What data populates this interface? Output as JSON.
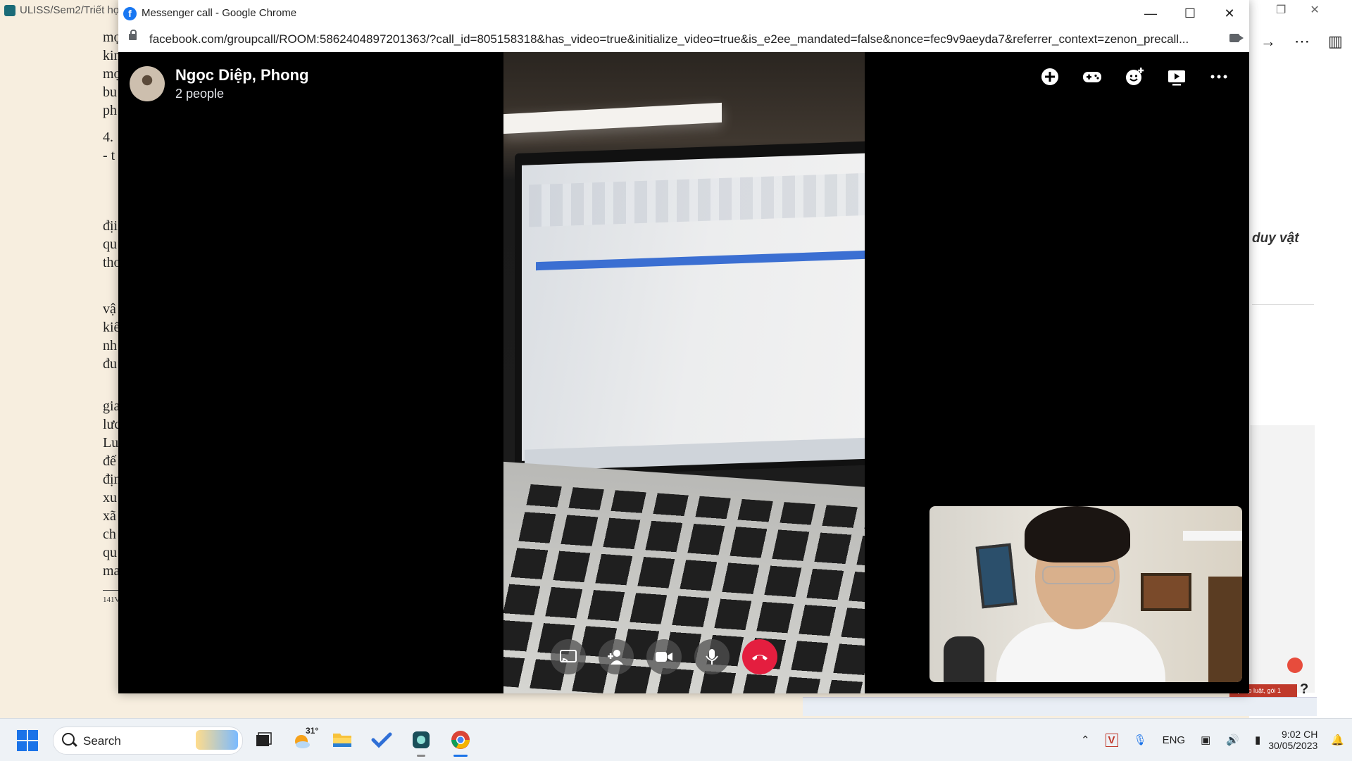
{
  "background": {
    "tab_title": "ULISS/Sem2/Triết học",
    "page_line_fragments": [
      "mọ",
      "kin",
      "mọ",
      "bu",
      "ph",
      "4.",
      "- t",
      "địi",
      "qu",
      "thơ",
      "vậ",
      "kiế",
      "nh",
      "đu",
      "gia",
      "lưc",
      "Lu",
      "đế",
      "địn",
      "xu",
      "xã",
      "ch",
      "qu",
      "ma"
    ],
    "footnote": "141V",
    "right_heading": "duy vật",
    "help_label": "?",
    "toast_text": "n pháp luật, gói 1"
  },
  "window": {
    "title": "Messenger call - Google Chrome",
    "url": "facebook.com/groupcall/ROOM:5862404897201363/?call_id=805158318&has_video=true&initialize_video=true&is_e2ee_mandated=false&nonce=fec9v9aeyda7&referrer_context=zenon_precall..."
  },
  "call": {
    "name": "Ngọc Diệp, Phong",
    "participants": "2 people",
    "top_actions": [
      "add-icon",
      "game-controller-icon",
      "effects-icon",
      "play-screen-icon",
      "more-icon"
    ],
    "controls": [
      "share-screen-icon",
      "add-person-icon",
      "camera-icon",
      "microphone-icon",
      "end-call-icon"
    ],
    "end_color": "#e41e3f"
  },
  "taskbar": {
    "search_label": "Search",
    "weather_temp": "31°",
    "apps": [
      "task-view-icon",
      "weather-icon",
      "file-explorer-icon",
      "todo-icon",
      "app-icon",
      "chrome-icon"
    ],
    "tray_lang": "ENG",
    "time": "9:02 CH",
    "date": "30/05/2023"
  }
}
